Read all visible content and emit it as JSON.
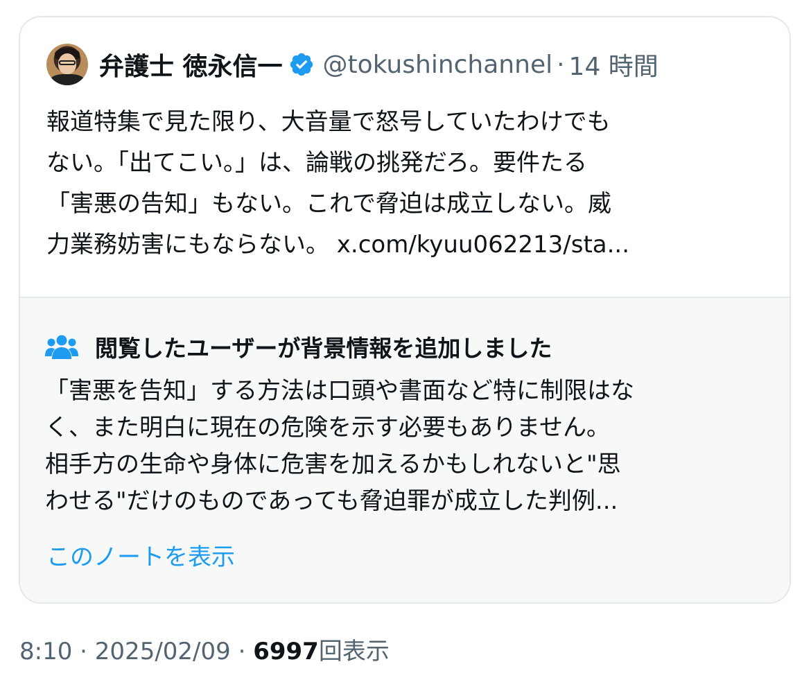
{
  "quoted_tweet": {
    "author_name": "弁護士 徳永信一",
    "handle": "@tokushinchannel",
    "separator": "·",
    "time_ago": "14 時間",
    "verified_icon": "verified-badge-icon",
    "avatar_icon": "avatar",
    "text_lines": [
      "報道特集で見た限り、大音量で怒号していたわけでも",
      "ない。「出てこい。」は、論戦の挑発だろ。要件たる",
      "「害悪の告知」もない。これで脅迫は成立しない。威",
      "力業務妨害にもならない。 x.com/kyuu062213/sta..."
    ]
  },
  "community_note": {
    "icon": "users-icon",
    "title": "閲覧したユーザーが背景情報を追加しました",
    "body_lines": [
      "「害悪を告知」する方法は口頭や書面など特に制限はな",
      "く、また明白に現在の危険を示す必要もありません。",
      "相手方の生命や身体に危害を加えるかもしれないと\"思",
      "わせる\"だけのものであっても脅迫罪が成立した判例..."
    ],
    "show_note_label": "このノートを表示"
  },
  "meta": {
    "time": "8:10",
    "dot1": "·",
    "date": "2025/02/09",
    "dot2": "·",
    "views_count": "6997",
    "views_label": "回表示"
  },
  "colors": {
    "accent_blue": "#1d9bf0",
    "secondary_text": "#536471",
    "primary_text": "#0f1419",
    "note_background": "#f7f9f9",
    "border": "#e3e8ec"
  }
}
